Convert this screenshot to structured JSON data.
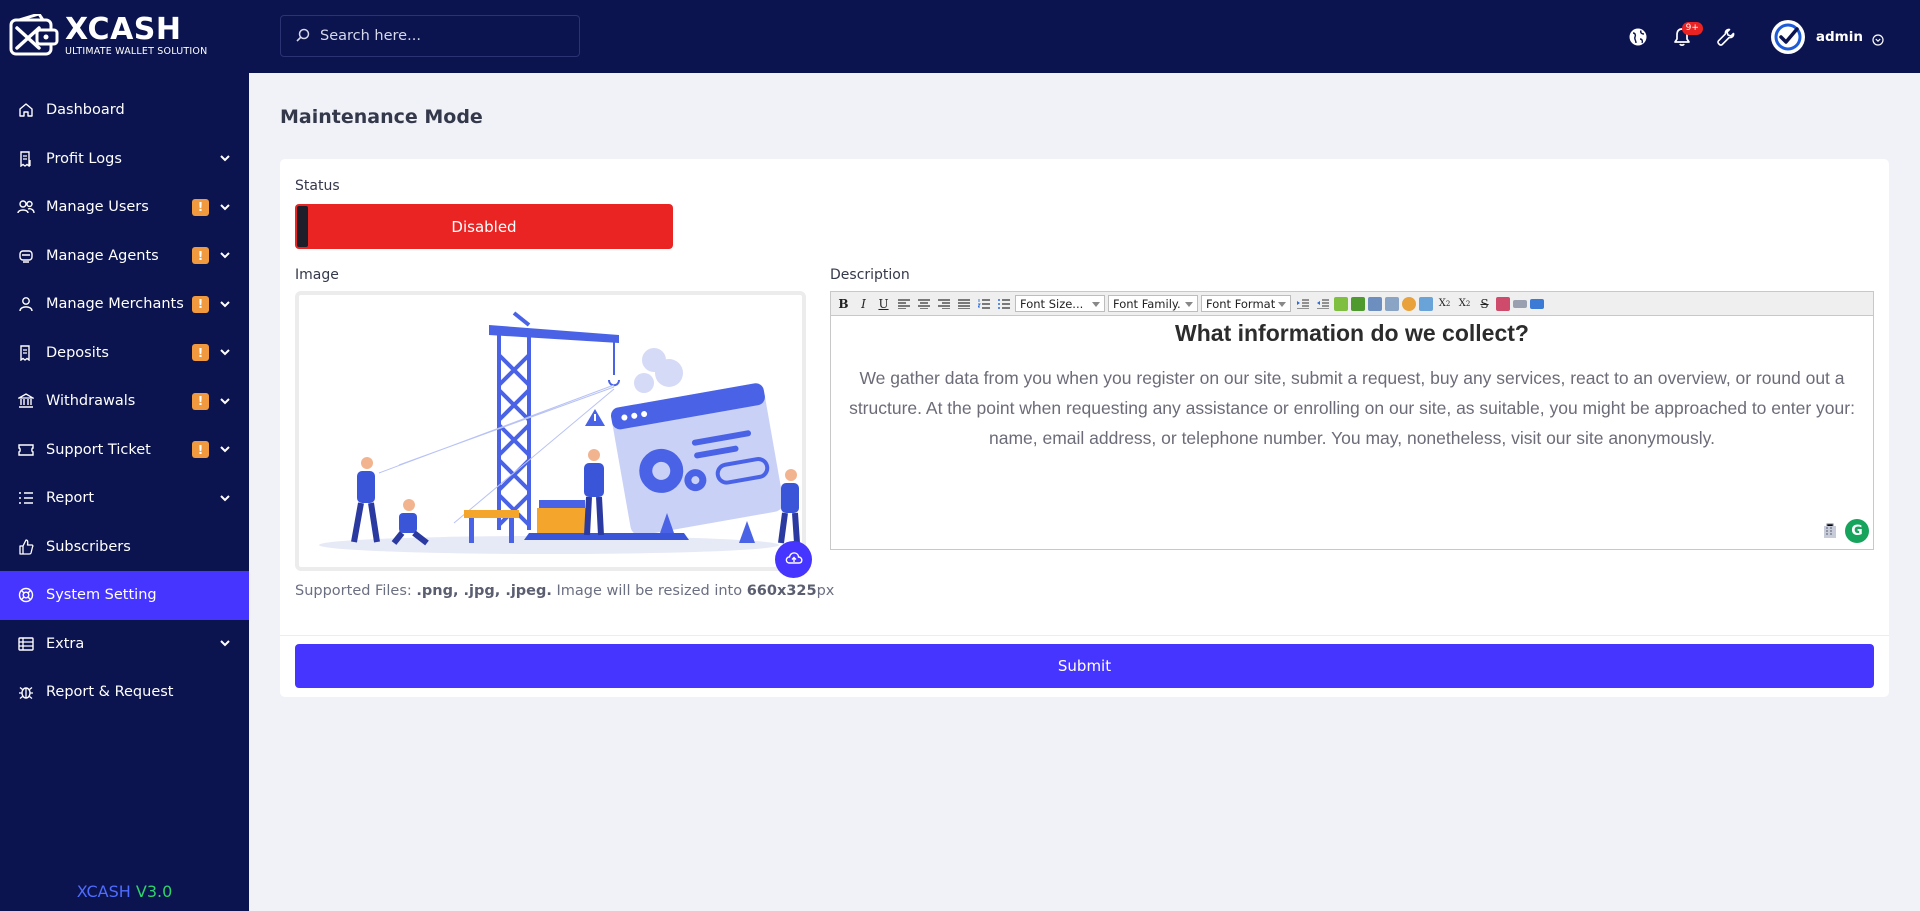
{
  "brand": {
    "name": "XCASH",
    "tagline": "ULTIMATE WALLET SOLUTION",
    "version_brand": "XCASH",
    "version_num": "V3.0",
    "accent": "#4634ff",
    "sidebar_bg": "#0b144f"
  },
  "search": {
    "placeholder": "Search here..."
  },
  "topbar": {
    "notification_badge": "9+",
    "user_name": "admin"
  },
  "sidebar": {
    "items": [
      {
        "label": "Dashboard",
        "icon": "home-icon"
      },
      {
        "label": "Profit Logs",
        "icon": "receipt-icon"
      },
      {
        "label": "Manage Users",
        "icon": "users-icon",
        "warn": "!"
      },
      {
        "label": "Manage Agents",
        "icon": "agents-icon",
        "warn": "!"
      },
      {
        "label": "Manage Merchants",
        "icon": "user-icon",
        "warn": "!"
      },
      {
        "label": "Deposits",
        "icon": "deposit-icon",
        "warn": "!"
      },
      {
        "label": "Withdrawals",
        "icon": "bank-icon",
        "warn": "!"
      },
      {
        "label": "Support Ticket",
        "icon": "ticket-icon",
        "warn": "!"
      },
      {
        "label": "Report",
        "icon": "list-icon"
      },
      {
        "label": "Subscribers",
        "icon": "thumbs-up-icon"
      },
      {
        "label": "System Setting",
        "icon": "lifering-icon"
      },
      {
        "label": "Extra",
        "icon": "server-icon"
      },
      {
        "label": "Report & Request",
        "icon": "bug-icon"
      }
    ],
    "active_index": 10
  },
  "page": {
    "title": "Maintenance Mode",
    "status_label": "Status",
    "status_value": "Disabled",
    "status_color": "#ea2323",
    "image_label": "Image",
    "description_label": "Description",
    "supported_prefix": "Supported Files:",
    "supported_types": ".png, .jpg, .jpeg.",
    "supported_mid": "Image will be resized into",
    "supported_size": "660x325",
    "supported_unit": "px",
    "submit_label": "Submit"
  },
  "editor": {
    "font_size": "Font Size...",
    "font_family": "Font Family.",
    "font_format": "Font Format",
    "heading": "What information do we collect?",
    "body": "We gather data from you when you register on our site, submit a request, buy any services, react to an overview, or round out a structure. At the point when requesting any assistance or enrolling on our site, as suitable, you might be approached to enter your: name, email address, or telephone number. You may, nonetheless, visit our site anonymously."
  }
}
